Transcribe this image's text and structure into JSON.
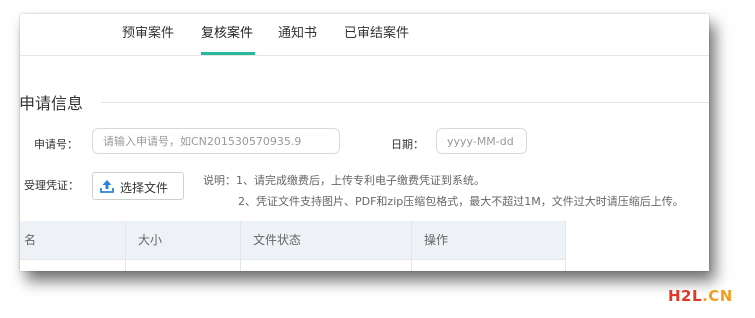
{
  "tabs": [
    {
      "label": "预审案件"
    },
    {
      "label": "复核案件"
    },
    {
      "label": "通知书"
    },
    {
      "label": "已审结案件"
    }
  ],
  "active_tab": "复核案件",
  "section": {
    "title": "申请信息"
  },
  "form": {
    "application_no_label": "申请号：",
    "application_no_placeholder": "请输入申请号，如CN201530570935.9",
    "date_label": "日期：",
    "date_placeholder": "yyyy-MM-dd",
    "voucher_label": "受理凭证：",
    "choose_file_label": "选择文件"
  },
  "notes": {
    "line1": "说明：1、请完成缴费后，上传专利电子缴费凭证到系统。",
    "line2": "2、凭证文件支持图片、PDF和zip压缩包格式，最大不超过1M，文件过大时请压缩后上传。"
  },
  "table": {
    "columns": [
      "名",
      "大小",
      "文件状态",
      "操作"
    ]
  },
  "colors": {
    "accent": "#27b99a",
    "watermark_h2l": "#e0392b",
    "watermark_cn": "#f0a020"
  },
  "watermark": {
    "h2l": "H2L",
    "dot_cn": ".CN"
  }
}
